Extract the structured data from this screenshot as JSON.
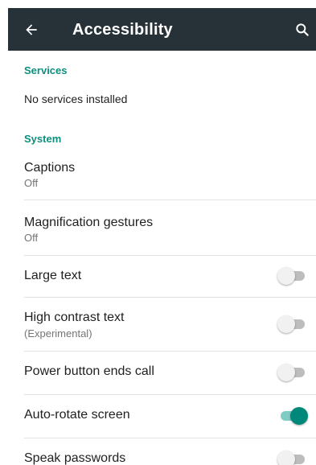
{
  "appbar": {
    "title": "Accessibility",
    "back_icon": "arrow-left-icon",
    "search_icon": "search-icon",
    "background_color": "#263238"
  },
  "colors": {
    "accent": "#00897b",
    "section_header": "#0b8f7e"
  },
  "services": {
    "header": "Services",
    "empty_text": "No services installed"
  },
  "system": {
    "header": "System",
    "items": [
      {
        "title": "Captions",
        "summary": "Off"
      },
      {
        "title": "Magnification gestures",
        "summary": "Off"
      },
      {
        "title": "Large text",
        "switch_on": false
      },
      {
        "title": "High contrast text",
        "summary": "(Experimental)",
        "switch_on": false
      },
      {
        "title": "Power button ends call",
        "switch_on": false
      },
      {
        "title": "Auto-rotate screen",
        "switch_on": true
      },
      {
        "title": "Speak passwords",
        "switch_on": false
      }
    ]
  }
}
